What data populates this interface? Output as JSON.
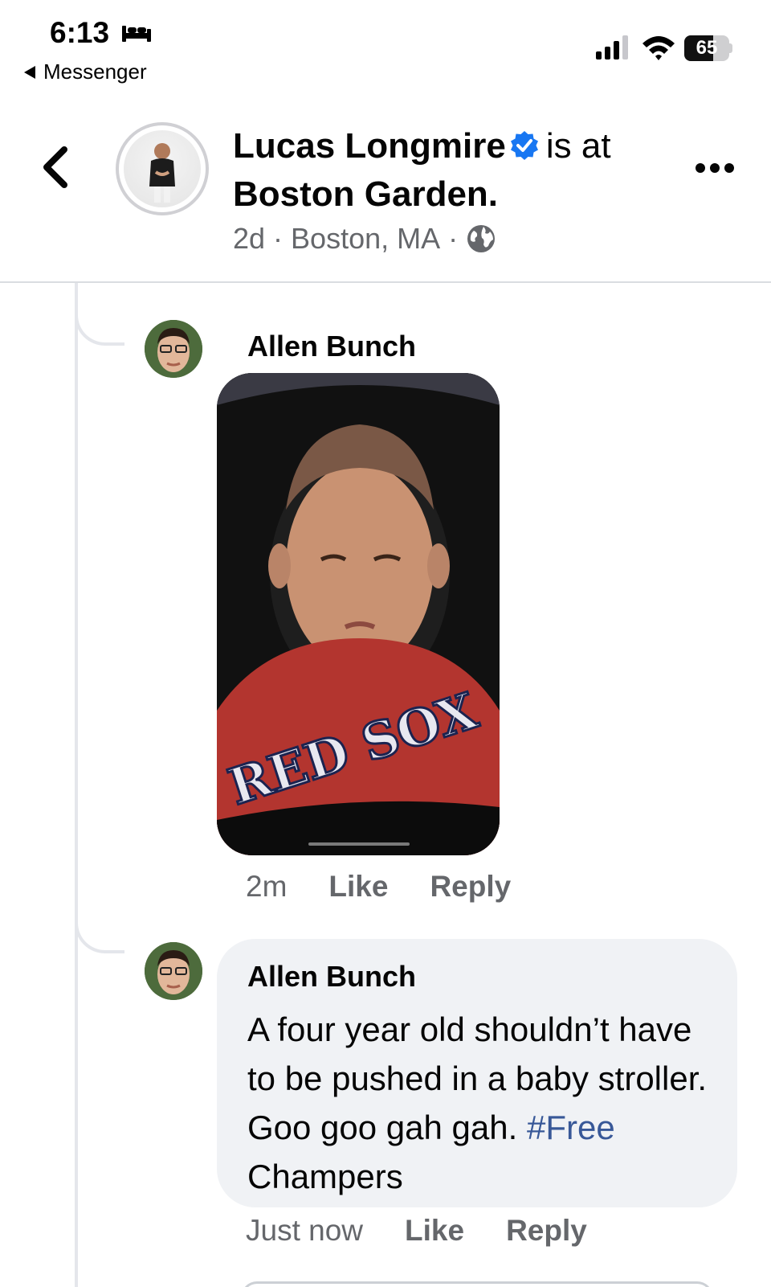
{
  "status_bar": {
    "time": "6:13",
    "back_app_label": "Messenger",
    "battery_level": "65",
    "battery_fraction": 0.65,
    "icons": [
      "bed-icon",
      "signal-icon",
      "wifi-icon",
      "battery-icon"
    ]
  },
  "header": {
    "author_name": "Lucas Longmire",
    "verb": "is at",
    "place": "Boston Garden.",
    "age": "2d",
    "location": "Boston, MA",
    "separator": "·",
    "icons": [
      "back-chevron-icon",
      "verified-badge-icon",
      "globe-icon",
      "more-icon"
    ]
  },
  "comments": [
    {
      "author": "Allen Bunch",
      "type": "gif",
      "gif_caption_visible": "RED SOX",
      "time": "2m",
      "like_label": "Like",
      "reply_label": "Reply"
    },
    {
      "author": "Allen Bunch",
      "type": "text",
      "text": "A four year old shouldn’t have to be pushed in a baby stroller. Goo goo gah gah.",
      "hashtag": "#Free",
      "text_after_hashtag": " Champers",
      "time": "Just now",
      "like_label": "Like",
      "reply_label": "Reply"
    }
  ],
  "colors": {
    "primary_text": "#050505",
    "secondary_text": "#65676b",
    "verified_blue": "#1877f2",
    "hashtag_blue": "#385898",
    "bubble_bg": "#f0f2f5",
    "thread_line": "#e4e6eb"
  }
}
